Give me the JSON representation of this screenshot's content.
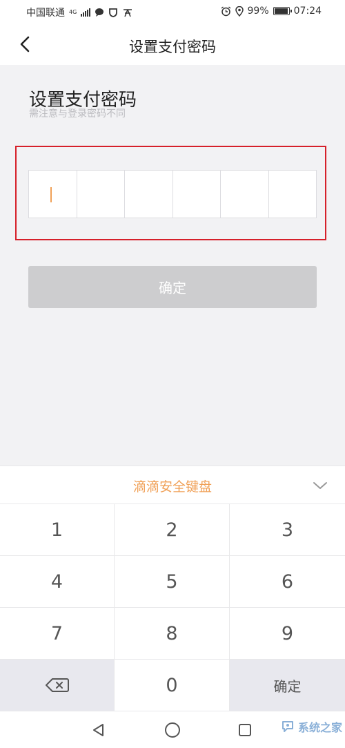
{
  "status_bar": {
    "carrier": "中国联通",
    "network": "4G",
    "battery": "99%",
    "time": "07:24"
  },
  "header": {
    "title": "设置支付密码"
  },
  "content": {
    "title": "设置支付密码",
    "subtitle": "需注意与登录密码不同",
    "pin_length": 6,
    "confirm_label": "确定"
  },
  "keyboard": {
    "title": "滴滴安全键盘",
    "keys": [
      "1",
      "2",
      "3",
      "4",
      "5",
      "6",
      "7",
      "8",
      "9"
    ],
    "zero": "0",
    "confirm": "确定"
  },
  "watermark": {
    "text": "系统之家"
  },
  "colors": {
    "accent": "#f0a056",
    "highlight": "#d6202a",
    "button_disabled": "#cdcdcf"
  }
}
